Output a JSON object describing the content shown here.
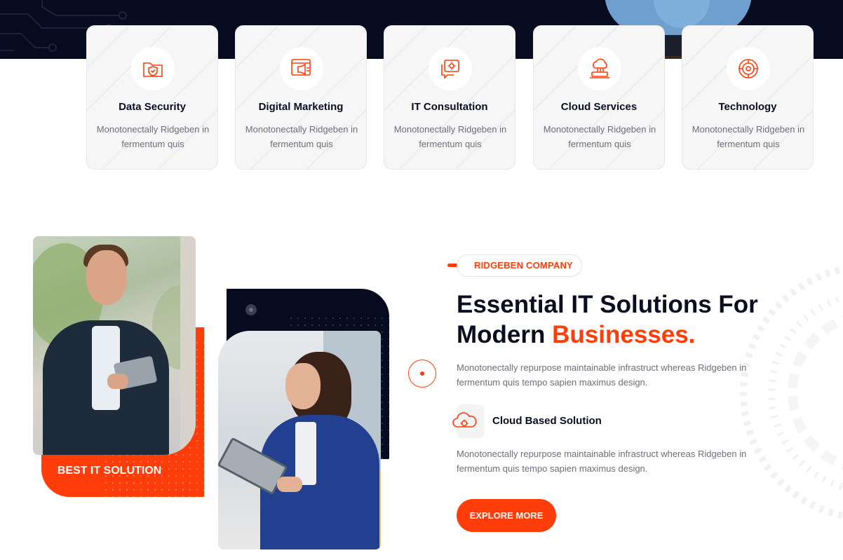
{
  "services": [
    {
      "title": "Data Security",
      "desc": "Monotonectally Ridgeben in fermentum quis",
      "icon": "shield-folder-icon"
    },
    {
      "title": "Digital Marketing",
      "desc": "Monotonectally Ridgeben in fermentum quis",
      "icon": "megaphone-browser-icon"
    },
    {
      "title": "IT Consultation",
      "desc": "Monotonectally Ridgeben in fermentum quis",
      "icon": "gear-chat-icon"
    },
    {
      "title": "Cloud Services",
      "desc": "Monotonectally Ridgeben in fermentum quis",
      "icon": "cloud-laptop-icon"
    },
    {
      "title": "Technology",
      "desc": "Monotonectally Ridgeben in fermentum quis",
      "icon": "tech-gear-icon"
    }
  ],
  "about": {
    "badge_label": "BEST IT SOLUTION",
    "tag": "RIDGEBEN COMPANY",
    "headline_main": "Essential IT Solutions For Modern ",
    "headline_accent": "Businesses.",
    "paragraph_1": "Monotonectally repurpose maintainable infrastruct whereas Ridgeben in fermentum quis tempo sapien maximus design.",
    "feature_title": "Cloud Based Solution",
    "feature_icon": "cloud-gear-icon",
    "paragraph_2": "Monotonectally repurpose maintainable infrastruct whereas Ridgeben in fermentum quis tempo sapien maximus design.",
    "button_label": "EXPLORE MORE"
  },
  "colors": {
    "accent": "#ff3d0a",
    "dark": "#070b1f",
    "text_muted": "#6b6f7a",
    "card_bg": "#f6f6f7"
  }
}
